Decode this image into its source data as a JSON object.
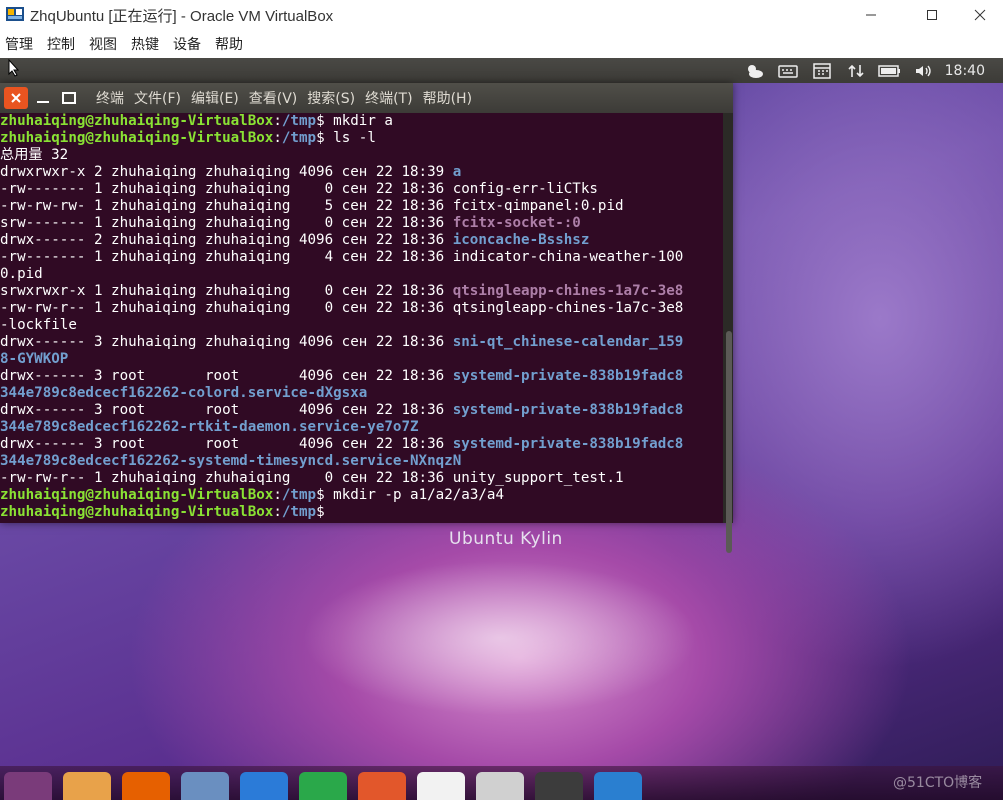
{
  "host_window": {
    "title": "ZhqUbuntu [正在运行] - Oracle VM VirtualBox",
    "minimize_glyph": "—",
    "maximize_glyph": "☐",
    "close_glyph": "✕"
  },
  "vbox_menu": [
    "管理",
    "控制",
    "视图",
    "热键",
    "设备",
    "帮助"
  ],
  "ubuntu_panel": {
    "clock": "18:40",
    "indicators": [
      "weather-icon",
      "keyboard-icon",
      "calendar-icon",
      "network-icon",
      "battery-icon",
      "volume-icon"
    ]
  },
  "terminal": {
    "menus": [
      "终端",
      "文件(F)",
      "编辑(E)",
      "查看(V)",
      "搜索(S)",
      "终端(T)",
      "帮助(H)"
    ],
    "prompt_user": "zhuhaiqing@zhuhaiqing-VirtualBox",
    "prompt_path": "/tmp",
    "lines": [
      {
        "type": "prompt",
        "cmd": " mkdir a"
      },
      {
        "type": "prompt",
        "cmd": " ls -l"
      },
      {
        "type": "text",
        "text": "总用量 32"
      },
      {
        "type": "entry",
        "meta": "drwxrwxr-x 2 zhuhaiqing zhuhaiqing 4096 сен 22 18:39 ",
        "name": "a",
        "style": "dir"
      },
      {
        "type": "entry",
        "meta": "-rw------- 1 zhuhaiqing zhuhaiqing    0 сен 22 18:36 ",
        "name": "config-err-liCTks",
        "style": "plain"
      },
      {
        "type": "entry",
        "meta": "-rw-rw-rw- 1 zhuhaiqing zhuhaiqing    5 сен 22 18:36 ",
        "name": "fcitx-qimpanel:0.pid",
        "style": "plain"
      },
      {
        "type": "entry",
        "meta": "srw------- 1 zhuhaiqing zhuhaiqing    0 сен 22 18:36 ",
        "name": "fcitx-socket-:0",
        "style": "sock"
      },
      {
        "type": "entry",
        "meta": "drwx------ 2 zhuhaiqing zhuhaiqing 4096 сен 22 18:36 ",
        "name": "iconcache-Bsshsz",
        "style": "dir"
      },
      {
        "type": "entry",
        "meta": "-rw------- 1 zhuhaiqing zhuhaiqing    4 сен 22 18:36 ",
        "name": "indicator-china-weather-100",
        "style": "plain"
      },
      {
        "type": "cont",
        "text": "0.pid",
        "style": "plain"
      },
      {
        "type": "entry",
        "meta": "srwxrwxr-x 1 zhuhaiqing zhuhaiqing    0 сен 22 18:36 ",
        "name": "qtsingleapp-chines-1a7c-3e8",
        "style": "sock"
      },
      {
        "type": "entry",
        "meta": "-rw-rw-r-- 1 zhuhaiqing zhuhaiqing    0 сен 22 18:36 ",
        "name": "qtsingleapp-chines-1a7c-3e8",
        "style": "plain"
      },
      {
        "type": "cont",
        "text": "-lockfile",
        "style": "plain"
      },
      {
        "type": "entry",
        "meta": "drwx------ 3 zhuhaiqing zhuhaiqing 4096 сен 22 18:36 ",
        "name": "sni-qt_chinese-calendar_159",
        "style": "dir"
      },
      {
        "type": "cont",
        "text": "8-GYWKOP",
        "style": "dir"
      },
      {
        "type": "entry",
        "meta": "drwx------ 3 root       root       4096 сен 22 18:36 ",
        "name": "systemd-private-838b19fadc8",
        "style": "dir"
      },
      {
        "type": "cont",
        "text": "344e789c8edcecf162262-colord.service-dXgsxa",
        "style": "dir"
      },
      {
        "type": "entry",
        "meta": "drwx------ 3 root       root       4096 сен 22 18:36 ",
        "name": "systemd-private-838b19fadc8",
        "style": "dir"
      },
      {
        "type": "cont",
        "text": "344e789c8edcecf162262-rtkit-daemon.service-ye7o7Z",
        "style": "dir"
      },
      {
        "type": "entry",
        "meta": "drwx------ 3 root       root       4096 сен 22 18:36 ",
        "name": "systemd-private-838b19fadc8",
        "style": "dir"
      },
      {
        "type": "cont",
        "text": "344e789c8edcecf162262-systemd-timesyncd.service-NXnqzN",
        "style": "dir"
      },
      {
        "type": "entry",
        "meta": "-rw-rw-r-- 1 zhuhaiqing zhuhaiqing    0 сен 22 18:36 ",
        "name": "unity_support_test.1",
        "style": "plain"
      },
      {
        "type": "prompt",
        "cmd": " mkdir -p a1/a2/a3/a4"
      },
      {
        "type": "prompt",
        "cmd": ""
      }
    ]
  },
  "desktop": {
    "logo_text": "Ubuntu Kylin",
    "watermark": "@51CTO博客"
  },
  "dock_items": [
    {
      "name": "dash-home-icon",
      "color": "#7a3b7a"
    },
    {
      "name": "files-folder-icon",
      "color": "#e8a24a"
    },
    {
      "name": "firefox-icon",
      "color": "#e66000"
    },
    {
      "name": "web-browser-icon",
      "color": "#6a8fc0"
    },
    {
      "name": "wps-writer-icon",
      "color": "#2b7bd8"
    },
    {
      "name": "wps-spreadsheet-icon",
      "color": "#2aa84a"
    },
    {
      "name": "wps-presentation-icon",
      "color": "#e2572b"
    },
    {
      "name": "software-center-icon",
      "color": "#f2f2f2"
    },
    {
      "name": "system-tools-icon",
      "color": "#d0d0d0"
    },
    {
      "name": "terminal-icon",
      "color": "#3c3c3c"
    },
    {
      "name": "workspace-switcher-icon",
      "color": "#2a7fd0"
    }
  ]
}
